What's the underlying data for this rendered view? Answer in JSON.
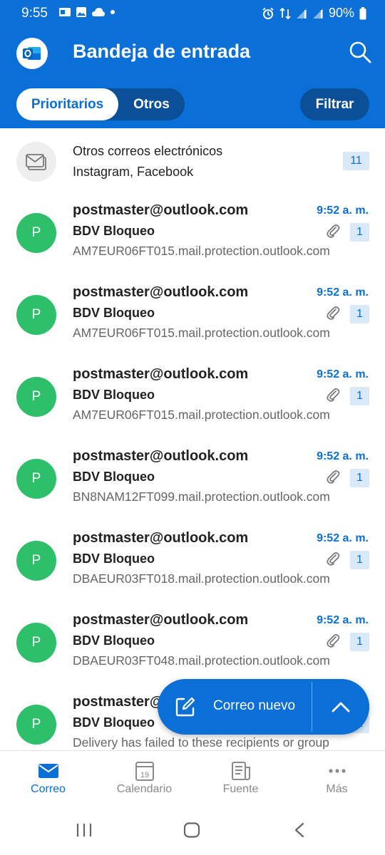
{
  "status_bar": {
    "time": "9:55",
    "battery": "90%"
  },
  "header": {
    "title": "Bandeja de entrada",
    "search_icon": "search-icon"
  },
  "tabs": {
    "focused": "Prioritarios",
    "other": "Otros",
    "filter": "Filtrar"
  },
  "other_mail": {
    "title": "Otros correos electrónicos",
    "subtitle": "Instagram, Facebook",
    "count": "11"
  },
  "emails": [
    {
      "avatar": "P",
      "sender": "postmaster@outlook.com",
      "time": "9:52 a. m.",
      "subject": "BDV Bloqueo",
      "count": "1",
      "preview": "AM7EUR06FT015.mail.protection.outlook.com"
    },
    {
      "avatar": "P",
      "sender": "postmaster@outlook.com",
      "time": "9:52 a. m.",
      "subject": "BDV Bloqueo",
      "count": "1",
      "preview": "AM7EUR06FT015.mail.protection.outlook.com"
    },
    {
      "avatar": "P",
      "sender": "postmaster@outlook.com",
      "time": "9:52 a. m.",
      "subject": "BDV Bloqueo",
      "count": "1",
      "preview": "AM7EUR06FT015.mail.protection.outlook.com"
    },
    {
      "avatar": "P",
      "sender": "postmaster@outlook.com",
      "time": "9:52 a. m.",
      "subject": "BDV Bloqueo",
      "count": "1",
      "preview": "BN8NAM12FT099.mail.protection.outlook.com"
    },
    {
      "avatar": "P",
      "sender": "postmaster@outlook.com",
      "time": "9:52 a. m.",
      "subject": "BDV Bloqueo",
      "count": "1",
      "preview": "DBAEUR03FT018.mail.protection.outlook.com"
    },
    {
      "avatar": "P",
      "sender": "postmaster@outlook.com",
      "time": "9:52 a. m.",
      "subject": "BDV Bloqueo",
      "count": "1",
      "preview": "DBAEUR03FT048.mail.protection.outlook.com"
    },
    {
      "avatar": "P",
      "sender": "postmaster@outlook.com",
      "time": "",
      "subject": "BDV Bloqueo",
      "count": "1",
      "preview": "Delivery has failed to these recipients or group"
    }
  ],
  "fab": {
    "label": "Correo nuevo"
  },
  "bottom_nav": [
    {
      "label": "Correo",
      "icon": "mail-icon",
      "active": true
    },
    {
      "label": "Calendario",
      "icon": "calendar-icon",
      "day": "19",
      "active": false
    },
    {
      "label": "Fuente",
      "icon": "feed-icon",
      "active": false
    },
    {
      "label": "Más",
      "icon": "more-icon",
      "active": false
    }
  ],
  "colors": {
    "brand": "#0a6fd6",
    "brand_dark": "#0a4f97",
    "avatar": "#2dbf6a",
    "badge_bg": "#d9e9f9"
  }
}
